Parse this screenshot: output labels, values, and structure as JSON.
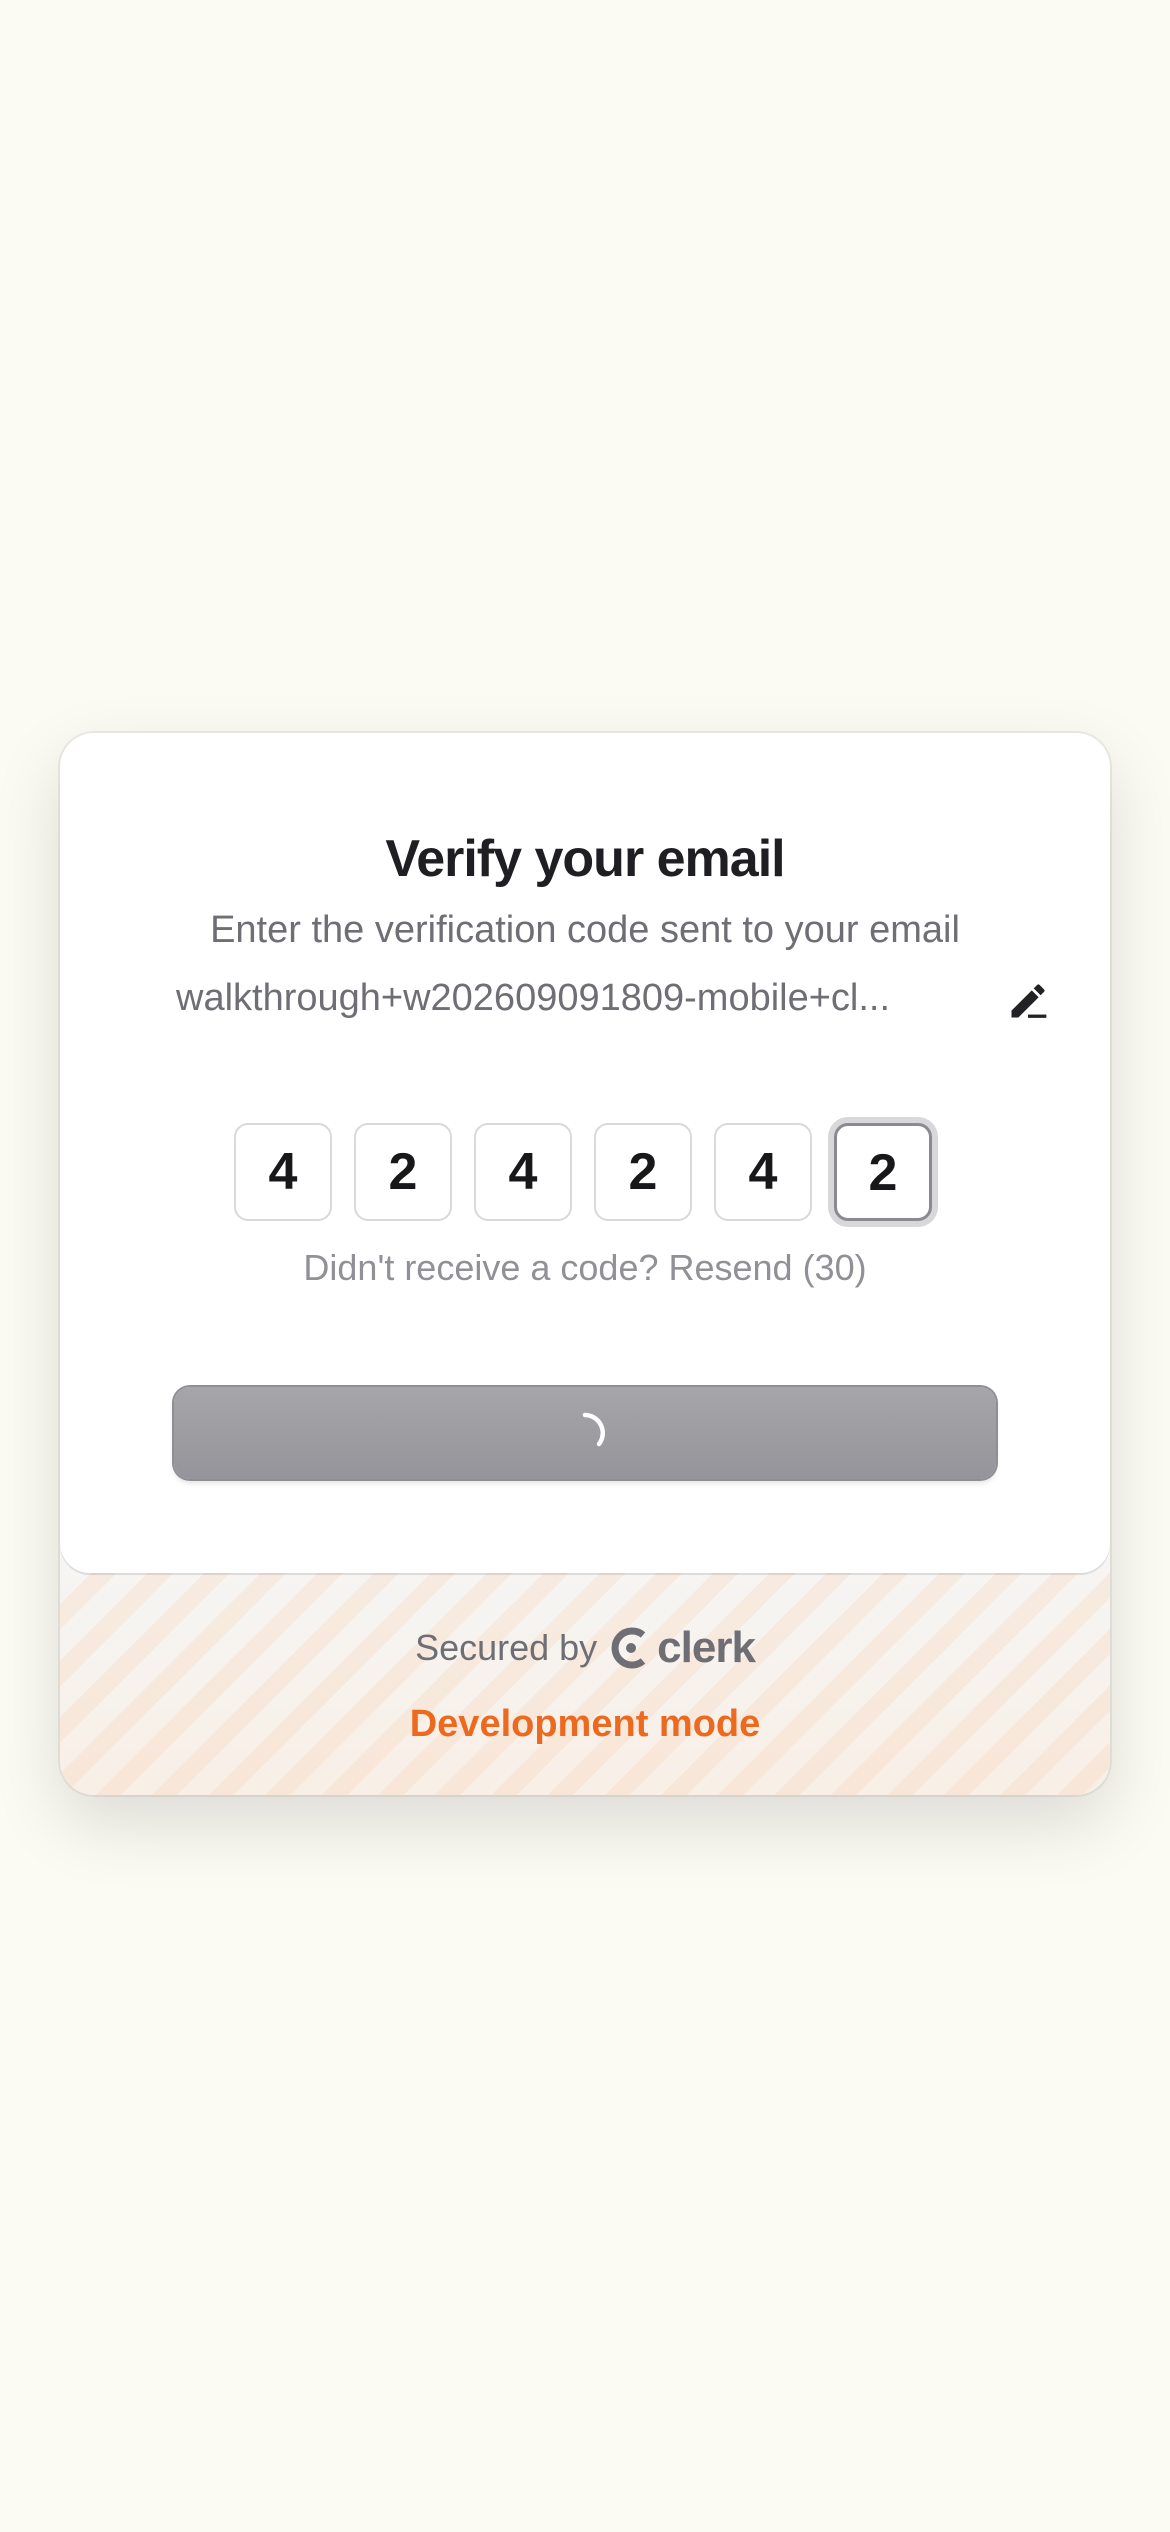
{
  "card": {
    "title": "Verify your email",
    "subtitle": "Enter the verification code sent to your email",
    "email": "walkthrough+w202609091809-mobile+cl...",
    "edit_icon": "pencil-edit-icon",
    "otp_digits": [
      "4",
      "2",
      "4",
      "2",
      "4",
      "2"
    ],
    "resend_text": "Didn't receive a code? Resend (30)",
    "continue_state": "loading",
    "continue_icon": "spinner-icon"
  },
  "footer": {
    "secured_by": "Secured by",
    "brand": "clerk",
    "brand_icon": "clerk-logo-icon",
    "dev_mode": "Development mode"
  },
  "colors": {
    "background": "#fbfaf3",
    "accent_orange": "#ec6a20",
    "button_gray": "#9d9da2"
  }
}
